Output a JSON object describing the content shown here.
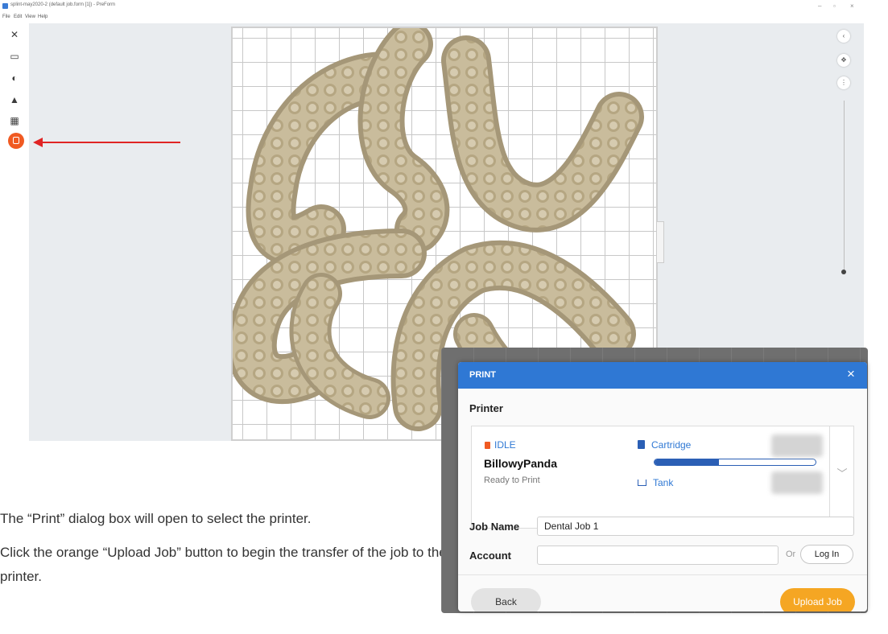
{
  "window": {
    "title": "splint-may2020-2 (default job.form [1]) - PreForm",
    "menu": [
      "File",
      "Edit",
      "View",
      "Help"
    ],
    "controls": [
      "–",
      "▫",
      "×"
    ]
  },
  "toolbar": {
    "tools": [
      "magic-wand-icon",
      "scale-icon",
      "orientation-icon",
      "supports-icon",
      "layout-icon",
      "print-icon"
    ]
  },
  "instructions": {
    "step1": "The “Print” dialog box will open to select the printer.",
    "step2": "Click the orange “Upload Job” button to begin the transfer of the job to the printer."
  },
  "dialog": {
    "title": "PRINT",
    "close": "×",
    "printer_section": "Printer",
    "printer": {
      "status": "IDLE",
      "name": "BillowyPanda",
      "sub": "Ready to Print",
      "cartridge_label": "Cartridge",
      "cartridge_level": 0.4,
      "tank_label": "Tank"
    },
    "job_name_label": "Job Name",
    "job_name_value": "Dental Job 1",
    "account_label": "Account",
    "account_value": "",
    "or_text": "Or",
    "login_label": "Log In",
    "back_label": "Back",
    "upload_label": "Upload Job"
  },
  "colors": {
    "accent_orange": "#f05a22",
    "upload_orange": "#f5a623",
    "header_blue": "#2f78d4",
    "arrow_red": "#e02424",
    "model_beige": "#c9bc9c"
  }
}
